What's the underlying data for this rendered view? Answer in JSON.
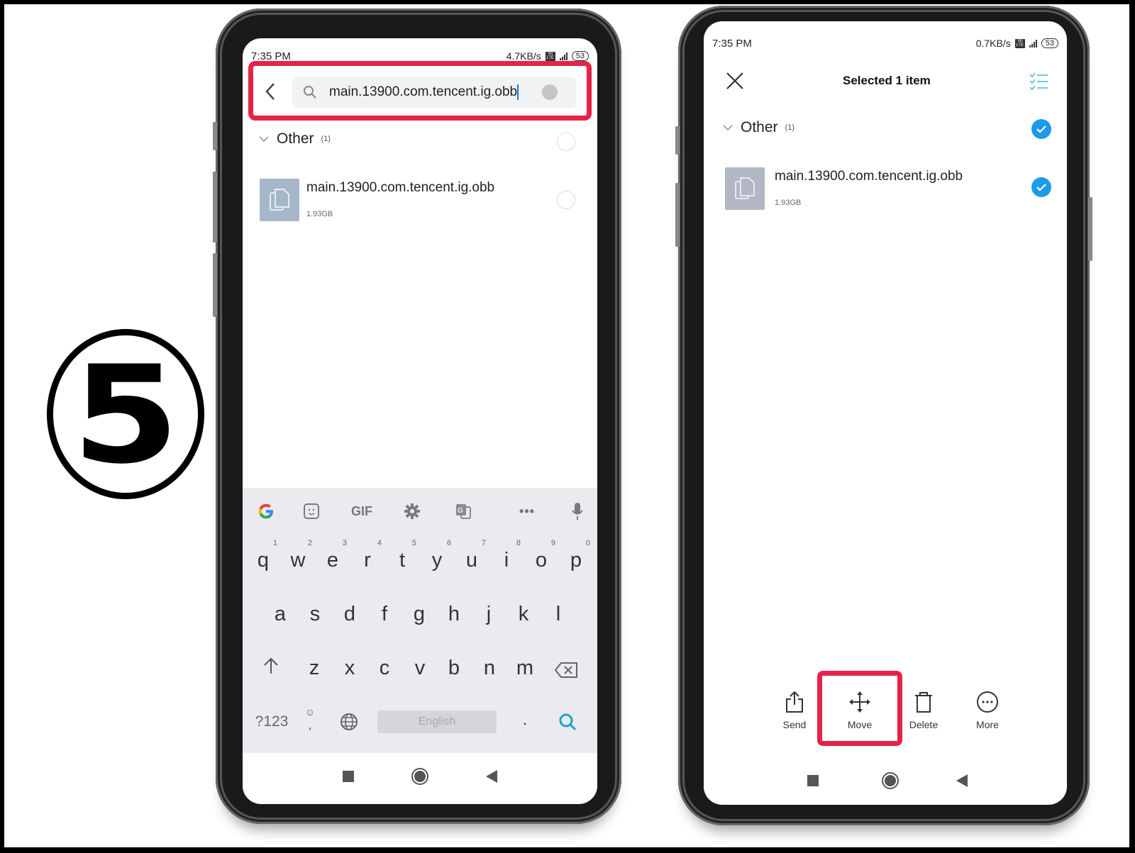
{
  "step_number": "5",
  "colors": {
    "highlight": "#e5234a",
    "check_blue": "#1b9be8",
    "search_accent": "#1ba5c8"
  },
  "left_phone": {
    "status_bar": {
      "time": "7:35 PM",
      "net_speed": "4.7KB/s",
      "network": "4G",
      "battery": "53"
    },
    "search": {
      "query": "main.13900.com.tencent.ig.obb",
      "icon": "search-icon",
      "back_icon": "chevron-left-icon"
    },
    "group": {
      "title": "Other",
      "count": "(1)"
    },
    "file": {
      "name": "main.13900.com.tencent.ig.obb",
      "size": "1.93GB"
    },
    "keyboard": {
      "toolbar": [
        "google-g-icon",
        "sticker-icon",
        "GIF",
        "gear-icon",
        "translate-icon",
        "more-dots-icon",
        "mic-icon"
      ],
      "gif_label": "GIF",
      "row1": [
        {
          "k": "q",
          "n": "1"
        },
        {
          "k": "w",
          "n": "2"
        },
        {
          "k": "e",
          "n": "3"
        },
        {
          "k": "r",
          "n": "4"
        },
        {
          "k": "t",
          "n": "5"
        },
        {
          "k": "y",
          "n": "6"
        },
        {
          "k": "u",
          "n": "7"
        },
        {
          "k": "i",
          "n": "8"
        },
        {
          "k": "o",
          "n": "9"
        },
        {
          "k": "p",
          "n": "0"
        }
      ],
      "row2": [
        "a",
        "s",
        "d",
        "f",
        "g",
        "h",
        "j",
        "k",
        "l"
      ],
      "row3": [
        "z",
        "x",
        "c",
        "v",
        "b",
        "n",
        "m"
      ],
      "symbols_label": "?123",
      "comma_label": ",",
      "space_label": "English",
      "period_label": "."
    }
  },
  "right_phone": {
    "status_bar": {
      "time": "7:35 PM",
      "net_speed": "0.7KB/s",
      "network": "4G",
      "battery": "53"
    },
    "header": {
      "title": "Selected 1 item"
    },
    "group": {
      "title": "Other",
      "count": "(1)",
      "selected": true
    },
    "file": {
      "name": "main.13900.com.tencent.ig.obb",
      "size": "1.93GB",
      "selected": true
    },
    "actions": [
      {
        "label": "Send",
        "icon": "share-icon"
      },
      {
        "label": "Move",
        "icon": "move-icon",
        "highlighted": true
      },
      {
        "label": "Delete",
        "icon": "trash-icon"
      },
      {
        "label": "More",
        "icon": "more-icon"
      }
    ]
  }
}
